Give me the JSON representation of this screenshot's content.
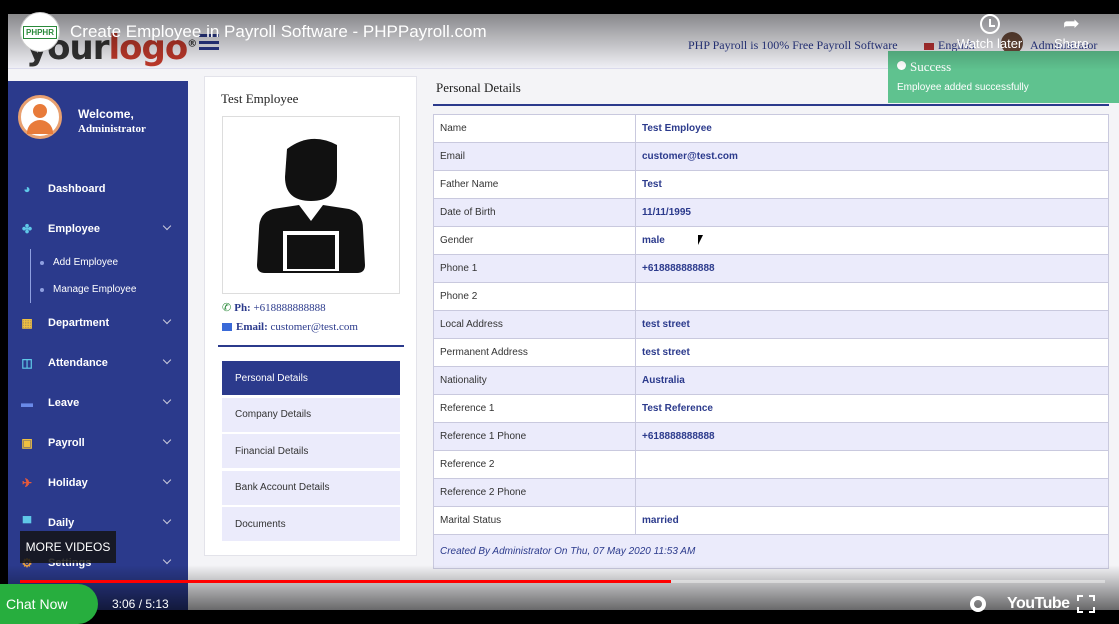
{
  "video": {
    "title": "Create Employee in Payroll Software - PHPPayroll.com",
    "channel_badge": "PHPHR",
    "watch_later": "Watch later",
    "share": "Share",
    "more_videos": "MORE VIDEOS",
    "time": "3:06 / 5:13",
    "progress": 0.6,
    "brand": "YouTube",
    "chat_now": "Chat Now"
  },
  "header": {
    "logo_text_a": "your",
    "logo_text_b": "logo",
    "logo_mark": "®",
    "tagline": "PHP Payroll is 100% Free Payroll Software",
    "language": "English",
    "user": "Administrator"
  },
  "sidebar": {
    "welcome": "Welcome,",
    "user": "Administrator",
    "items": [
      {
        "label": "Dashboard",
        "icon": "dashboard-icon",
        "glyph": "◕"
      },
      {
        "label": "Employee",
        "icon": "users-icon",
        "glyph": "✤"
      },
      {
        "label": "Department",
        "icon": "grid-icon",
        "glyph": "▦"
      },
      {
        "label": "Attendance",
        "icon": "calendar-icon",
        "glyph": "◫"
      },
      {
        "label": "Leave",
        "icon": "bed-icon",
        "glyph": "▬"
      },
      {
        "label": "Payroll",
        "icon": "money-icon",
        "glyph": "▣"
      },
      {
        "label": "Holiday",
        "icon": "plane-icon",
        "glyph": "✈"
      },
      {
        "label": "Daily",
        "icon": "calendar-daily-icon",
        "glyph": "▀"
      },
      {
        "label": "Settings",
        "icon": "cog-icon",
        "glyph": "⚙"
      }
    ],
    "employee_sub": [
      "Add Employee",
      "Manage Employee"
    ]
  },
  "profile": {
    "name": "Test Employee",
    "phone_label": "Ph:",
    "phone": "+618888888888",
    "email_label": "Email:",
    "email": "customer@test.com",
    "tabs": [
      "Personal Details",
      "Company Details",
      "Financial Details",
      "Bank Account Details",
      "Documents"
    ]
  },
  "details": {
    "title": "Personal Details",
    "rows": [
      {
        "k": "Name",
        "v": "Test Employee"
      },
      {
        "k": "Email",
        "v": "customer@test.com"
      },
      {
        "k": "Father Name",
        "v": "Test"
      },
      {
        "k": "Date of Birth",
        "v": "11/11/1995"
      },
      {
        "k": "Gender",
        "v": "male"
      },
      {
        "k": "Phone 1",
        "v": "+618888888888"
      },
      {
        "k": "Phone 2",
        "v": ""
      },
      {
        "k": "Local Address",
        "v": "test street"
      },
      {
        "k": "Permanent Address",
        "v": "test street"
      },
      {
        "k": "Nationality",
        "v": "Australia"
      },
      {
        "k": "Reference 1",
        "v": "Test Reference"
      },
      {
        "k": "Reference 1 Phone",
        "v": "+618888888888"
      },
      {
        "k": "Reference 2",
        "v": ""
      },
      {
        "k": "Reference 2 Phone",
        "v": ""
      },
      {
        "k": "Marital Status",
        "v": "married"
      }
    ],
    "footer": "Created By Administrator On Thu, 07 May 2020 11:53 AM"
  },
  "toast": {
    "title": "Success",
    "message": "Employee added successfully"
  },
  "colors": {
    "primary": "#2b3a8c",
    "stripe": "#ebebfb",
    "success": "#5fc28f",
    "progress": "#ff0000"
  }
}
